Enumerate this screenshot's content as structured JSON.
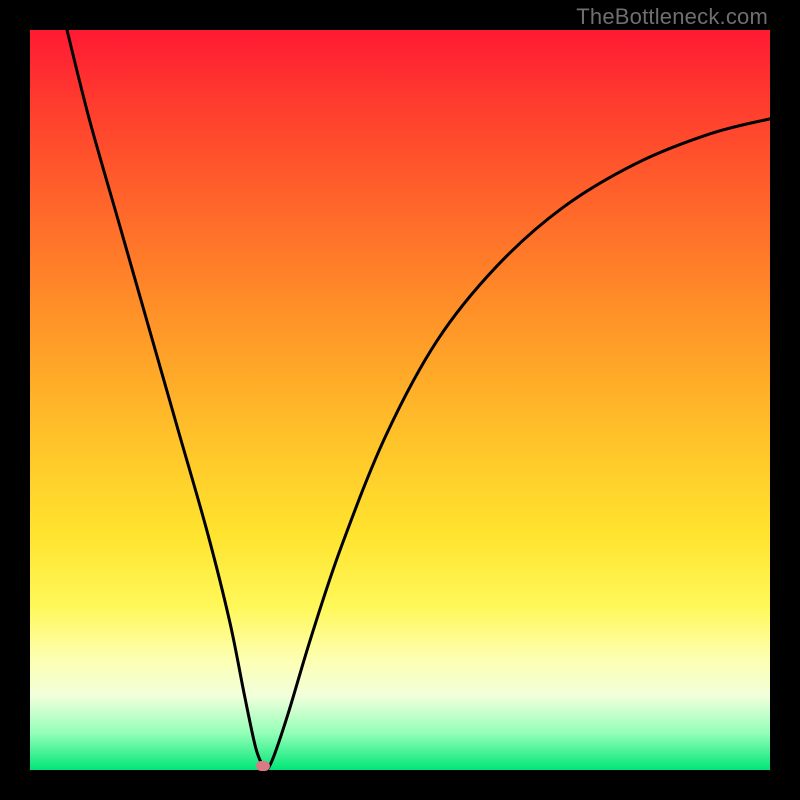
{
  "watermark": "TheBottleneck.com",
  "chart_data": {
    "type": "line",
    "title": "",
    "xlabel": "",
    "ylabel": "",
    "xlim": [
      0,
      100
    ],
    "ylim": [
      0,
      100
    ],
    "grid": false,
    "legend": false,
    "series": [
      {
        "name": "bottleneck-curve",
        "x": [
          5,
          8,
          12,
          16,
          20,
          24,
          27,
          29,
          30.5,
          31.5,
          32,
          33,
          35,
          38,
          42,
          48,
          55,
          63,
          72,
          82,
          92,
          100
        ],
        "y": [
          100,
          88,
          74,
          60,
          46,
          32,
          20,
          10,
          3,
          0.5,
          0,
          2,
          8,
          18,
          30,
          45,
          58,
          68,
          76,
          82,
          86,
          88
        ]
      }
    ],
    "annotations": [
      {
        "name": "min-marker",
        "x": 31.5,
        "y": 0.5,
        "shape": "pill",
        "color": "#d97a84"
      }
    ]
  },
  "colors": {
    "curve": "#000000",
    "marker": "#d97a84",
    "background_frame": "#000000"
  }
}
